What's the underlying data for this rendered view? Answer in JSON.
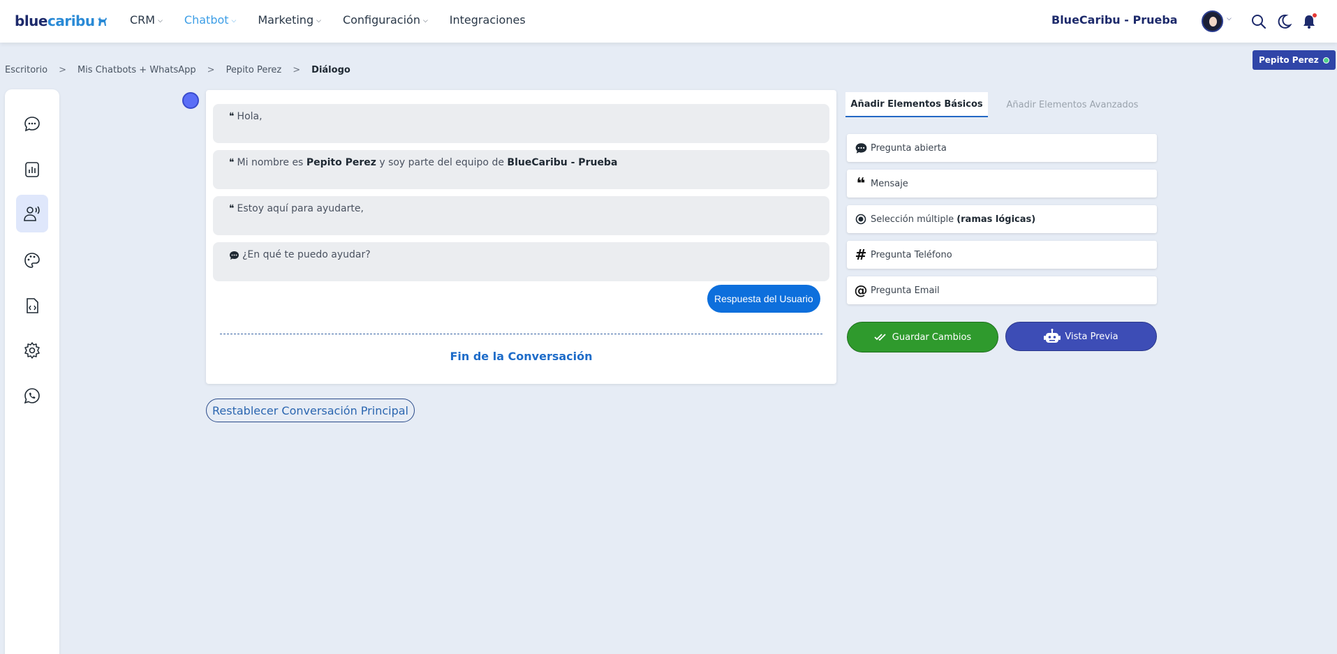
{
  "logo": {
    "part1": "blue",
    "part2": "caribu"
  },
  "nav": [
    {
      "label": "CRM",
      "has_dropdown": true
    },
    {
      "label": "Chatbot",
      "has_dropdown": true,
      "active": true
    },
    {
      "label": "Marketing",
      "has_dropdown": true
    },
    {
      "label": "Configuración",
      "has_dropdown": true
    },
    {
      "label": "Integraciones",
      "has_dropdown": false
    }
  ],
  "header": {
    "company": "BlueCaribu - Prueba"
  },
  "breadcrumb": [
    "Escritorio",
    "Mis Chatbots + WhatsApp",
    "Pepito Perez",
    "Diálogo"
  ],
  "breadcrumb_sep": ">",
  "user_badge": {
    "name": "Pepito Perez",
    "status_color": "#4fd18b"
  },
  "sidebar": [
    {
      "icon": "chat-bubble-icon"
    },
    {
      "icon": "bar-chart-icon"
    },
    {
      "icon": "user-voice-icon",
      "active": true
    },
    {
      "icon": "palette-icon"
    },
    {
      "icon": "code-file-icon"
    },
    {
      "icon": "gear-icon"
    },
    {
      "icon": "whatsapp-icon"
    }
  ],
  "conversation": {
    "messages": [
      {
        "icon": "quote-icon",
        "text": "Hola,"
      },
      {
        "icon": "quote-icon",
        "pre": "Mi nombre es ",
        "bold1": "Pepito Perez",
        "mid": " y soy parte del equipo de ",
        "bold2": "BlueCaribu - Prueba"
      },
      {
        "icon": "quote-icon",
        "text": "Estoy aquí para ayudarte,"
      },
      {
        "icon": "comment-icon",
        "text": "¿En qué te puedo ayudar?"
      }
    ],
    "reply_button": "Respuesta del Usuario",
    "end_label": "Fin de la Conversación"
  },
  "reset_button": "Restablecer Conversación Principal",
  "tabs": {
    "basic": "Añadir Elementos Básicos",
    "advanced": "Añadir Elementos Avanzados"
  },
  "elements": [
    {
      "icon": "comment-icon",
      "label": "Pregunta abierta"
    },
    {
      "icon": "quote-icon",
      "label": "Mensaje"
    },
    {
      "icon": "radio-icon",
      "label": "Selección múltiple",
      "bold": "(ramas lógicas)"
    },
    {
      "icon": "hash-icon",
      "label": "Pregunta Teléfono"
    },
    {
      "icon": "at-icon",
      "label": "Pregunta Email"
    }
  ],
  "buttons": {
    "save": "Guardar Cambios",
    "preview": "Vista Previa"
  },
  "colors": {
    "accent": "#3d9ee6",
    "save": "#2f9a2d",
    "preview": "#3d4db6",
    "reply": "#0d6fdc"
  }
}
